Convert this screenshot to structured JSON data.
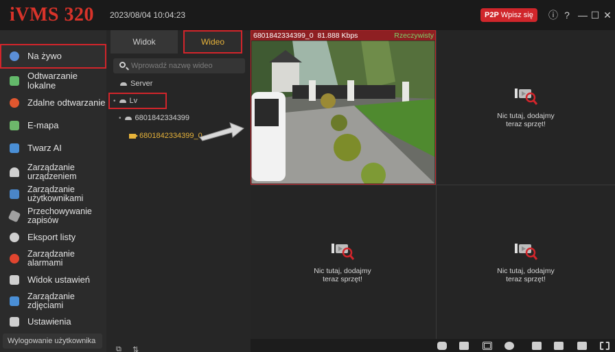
{
  "app": {
    "logo": "iVMS 320",
    "datetime": "2023/08/04 10:04:23",
    "p2p_prefix": "P2P",
    "p2p_login": "Wpisz się"
  },
  "sidebar": {
    "items": [
      {
        "label": "Na żywo",
        "icon": "live-view-icon",
        "color": "#5b8fd8"
      },
      {
        "label": "Odtwarzanie lokalne",
        "icon": "local-playback-icon",
        "color": "#63b96a"
      },
      {
        "label": "Zdalne odtwarzanie",
        "icon": "remote-playback-icon",
        "color": "#e0572f"
      },
      {
        "label": "E-mapa",
        "icon": "emap-icon",
        "color": "#6db86b"
      },
      {
        "label": "Twarz AI",
        "icon": "face-ai-icon",
        "color": "#4a8fd6"
      },
      {
        "label": "Zarządzanie urządzeniem",
        "icon": "device-management-icon",
        "color": "#cfcfcf"
      },
      {
        "label": "Zarządzanie użytkownikami",
        "icon": "user-management-icon",
        "color": "#4a86c8"
      },
      {
        "label": "Przechowywanie zapisów",
        "icon": "storage-icon",
        "color": "#a0a0a0"
      },
      {
        "label": "Eksport listy",
        "icon": "export-icon",
        "color": "#cfcfcf"
      },
      {
        "label": "Zarządzanie alarmami",
        "icon": "alarm-icon",
        "color": "#e0452f"
      },
      {
        "label": "Widok ustawień",
        "icon": "view-settings-icon",
        "color": "#cfcfcf"
      },
      {
        "label": "Zarządzanie zdjęciami",
        "icon": "image-management-icon",
        "color": "#4a8fd6"
      },
      {
        "label": "Ustawienia",
        "icon": "settings-icon",
        "color": "#cfcfcf"
      }
    ],
    "logout": "Wylogowanie użytkownika"
  },
  "panel": {
    "tab_widok": "Widok",
    "tab_wideo": "Wideo",
    "search_placeholder": "Wprowadź nazwę wideo",
    "tree": {
      "server": "Server",
      "lv": "Lv",
      "device": "6801842334399",
      "channel": "6801842334399_0"
    }
  },
  "video": {
    "channel": "6801842334399_0",
    "bitrate": "81.888 Kbps",
    "mode": "Rzeczywisty",
    "empty_line1": "Nic tutaj, dodajmy",
    "empty_line2": "teraz sprzęt!"
  },
  "colors": {
    "accent_red": "#d3252b",
    "selected_yellow": "#e7b33a",
    "live_green": "#7fd36b"
  }
}
